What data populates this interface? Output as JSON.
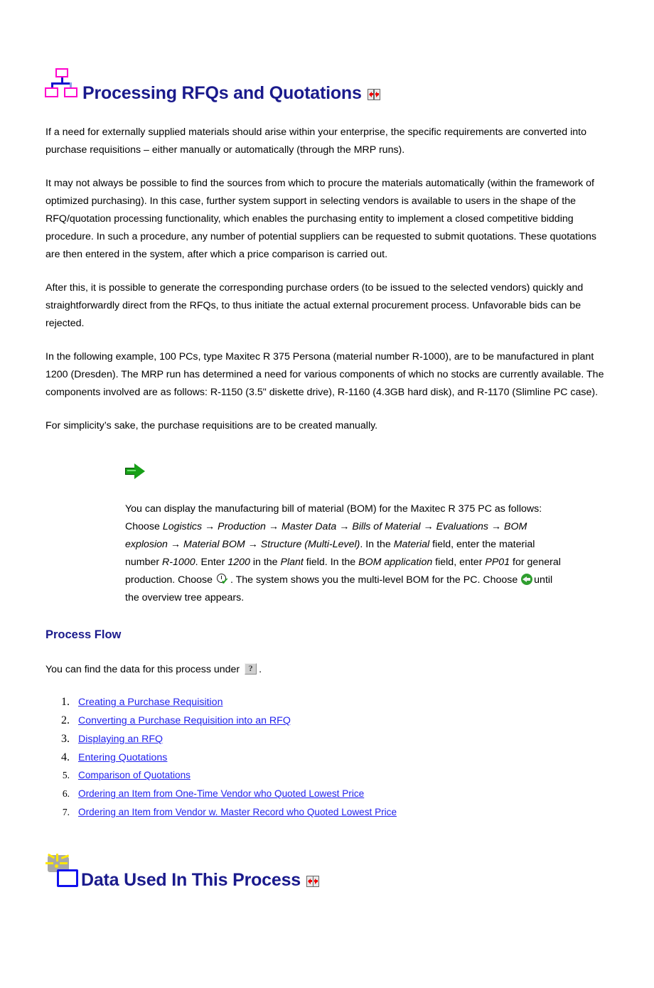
{
  "document": {
    "title": "Processing RFQs and Quotations",
    "title_icon": "hierarchy-tree-icon",
    "title_suffix_icon": "split-horizontal-icon"
  },
  "intro": {
    "p1": "If a need for externally supplied materials should arise within your enterprise, the specific requirements are converted into purchase requisitions – either manually or automatically (through the MRP runs).",
    "p2": "It may not always be possible to find the sources from which to procure the materials automatically (within the framework of optimized purchasing). In this case, further system support in selecting vendors is available to users in the shape of the RFQ/quotation processing functionality, which enables the purchasing entity to implement a closed competitive bidding procedure. In such a procedure, any number of potential suppliers can be requested to submit quotations. These quotations are then entered in the system, after which a price comparison is carried out.",
    "p3": "After this, it is possible to generate the corresponding purchase orders (to be issued to the selected vendors) quickly and straightforwardly direct from the RFQs, to thus initiate the actual external procurement process. Unfavorable bids can be rejected.",
    "p4": "In the following example, 100 PCs, type Maxitec R 375 Persona (material number R-1000), are to be manufactured in plant 1200 (Dresden). The MRP run has determined a need for various components of which no stocks are currently available. The components involved are as follows: R-1150 (3.5\" diskette drive), R-1160 (4.3GB hard disk), and R-1170 (Slimline PC case).",
    "p5": "For simplicity’s sake, the purchase requisitions are to be created manually."
  },
  "note": {
    "marker_icon": "green-arrow-icon",
    "line1": "You can display the manufacturing bill of material (BOM) for the Maxitec R 375 PC as follows:",
    "choose_label": "Choose ",
    "menu_path": "Logistics → Production → Master Data → Bills of Material → Evaluations → BOM explosion → Material BOM → Structure (Multi-Level)",
    "after_path": ". In the ",
    "field_material": "Material",
    "t1": " field, enter the material number ",
    "value_material": "R-1000",
    "t2": ". Enter ",
    "value_plant": "1200",
    "t3": " in the ",
    "field_plant": "Plant",
    "t4": " field. In the ",
    "field_bom_application": "BOM application",
    "t5": " field, enter ",
    "value_bom_application": "PP01",
    "t6": " for general production. Choose ",
    "enter_icon": "enter-clock-check-icon",
    "t7": ". The system shows you the multi-level BOM for the PC. Choose ",
    "back_icon": "back-arrow-icon",
    "t8": "until the overview tree appears."
  },
  "process_flow": {
    "heading": "Process Flow",
    "lead_before": "You can find the data for this process under ",
    "help_icon": "help-question-icon",
    "lead_after": ".",
    "steps": [
      {
        "num": "1.",
        "label": "Creating a Purchase Requisition",
        "size": "big"
      },
      {
        "num": "2.",
        "label": "Converting a Purchase Requisition into an RFQ",
        "size": "big"
      },
      {
        "num": "3.",
        "label": "Displaying an RFQ",
        "size": "big"
      },
      {
        "num": "4.",
        "label": "Entering Quotations",
        "size": "big"
      },
      {
        "num": "5.",
        "label": "Comparison of Quotations",
        "size": "small"
      },
      {
        "num": "6.",
        "label": "Ordering an Item from One-Time Vendor who Quoted Lowest Price",
        "size": "small"
      },
      {
        "num": "7.",
        "label": "Ordering an Item from Vendor w. Master Record who Quoted Lowest Price",
        "size": "small"
      }
    ]
  },
  "data_section": {
    "title": "Data Used In This Process",
    "title_icon": "data-lightbulb-icon",
    "title_suffix_icon": "split-horizontal-icon"
  },
  "colors": {
    "heading_blue": "#1a1a8c",
    "link_blue": "#2222ee",
    "icon_magenta": "#ff00cc",
    "icon_blue": "#1111cc",
    "arrow_green": "#17a017",
    "spark_yellow": "#ffe800",
    "accent_red": "#ee0000"
  }
}
